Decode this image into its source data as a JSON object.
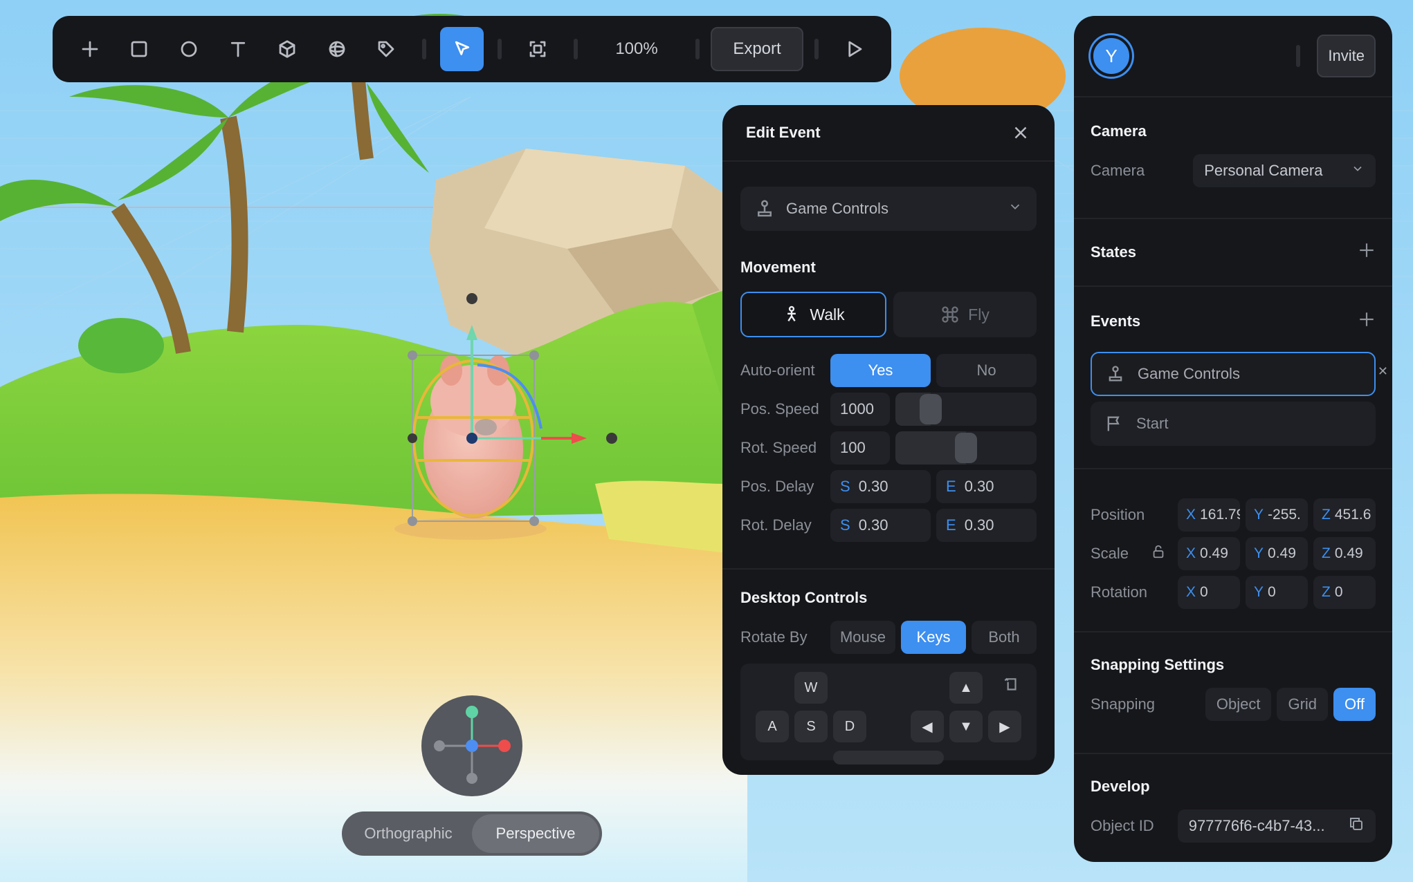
{
  "toolbar": {
    "zoom": "100%",
    "export_label": "Export"
  },
  "event_panel": {
    "title": "Edit Event",
    "controls_dropdown": "Game Controls",
    "movement_title": "Movement",
    "walk_label": "Walk",
    "fly_label": "Fly",
    "auto_orient_label": "Auto-orient",
    "auto_orient_yes": "Yes",
    "auto_orient_no": "No",
    "pos_speed_label": "Pos. Speed",
    "pos_speed_value": "1000",
    "pos_speed_level": 0.25,
    "rot_speed_label": "Rot. Speed",
    "rot_speed_value": "100",
    "rot_speed_level": 0.5,
    "pos_delay_label": "Pos. Delay",
    "pos_delay_s": "0.30",
    "pos_delay_e": "0.30",
    "rot_delay_label": "Rot. Delay",
    "rot_delay_s": "0.30",
    "rot_delay_e": "0.30",
    "s_key": "S",
    "e_key": "E",
    "desktop_title": "Desktop Controls",
    "rotate_by_label": "Rotate By",
    "rotate_mouse": "Mouse",
    "rotate_keys": "Keys",
    "rotate_both": "Both",
    "keys": {
      "w": "W",
      "a": "A",
      "s": "S",
      "d": "D"
    }
  },
  "inspector": {
    "avatar_letter": "Y",
    "invite_label": "Invite",
    "camera_title": "Camera",
    "camera_label": "Camera",
    "camera_value": "Personal Camera",
    "states_title": "States",
    "events_title": "Events",
    "event_items": [
      "Game Controls",
      "Start"
    ],
    "position_label": "Position",
    "position": {
      "x": "161.79",
      "y": "-255.",
      "z": "451.6"
    },
    "scale_label": "Scale",
    "scale": {
      "x": "0.49",
      "y": "0.49",
      "z": "0.49"
    },
    "rotation_label": "Rotation",
    "rotation": {
      "x": "0",
      "y": "0",
      "z": "0"
    },
    "axis": {
      "x": "X",
      "y": "Y",
      "z": "Z"
    },
    "snapping_title": "Snapping Settings",
    "snapping_label": "Snapping",
    "snap_object": "Object",
    "snap_grid": "Grid",
    "snap_off": "Off",
    "develop_title": "Develop",
    "object_id_label": "Object ID",
    "object_id": "977776f6-c4b7-43..."
  },
  "view_toggle": {
    "orthographic": "Orthographic",
    "perspective": "Perspective"
  },
  "colors": {
    "accent": "#3d8ff0",
    "panel_bg": "#16171b",
    "sky": "#9ad3f5"
  }
}
